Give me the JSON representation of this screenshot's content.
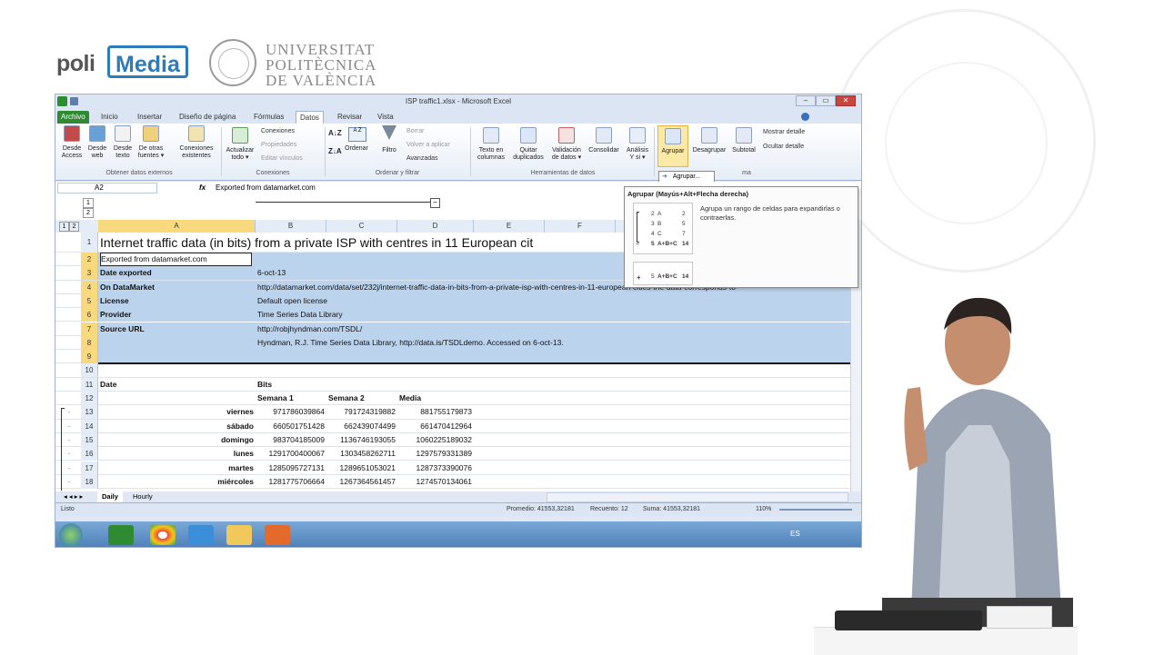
{
  "branding": {
    "poli": "poli",
    "media": "Media",
    "university_lines": [
      "UNIVERSITAT",
      "POLITÈCNICA",
      "DE VALÈNCIA"
    ]
  },
  "window": {
    "title": "ISP traffic1.xlsx - Microsoft Excel",
    "controls": [
      "–",
      "▭",
      "✕"
    ]
  },
  "tabs": [
    "Archivo",
    "Inicio",
    "Insertar",
    "Diseño de página",
    "Fórmulas",
    "Datos",
    "Revisar",
    "Vista"
  ],
  "active_tab": "Datos",
  "ribbon": {
    "get_external": {
      "buttons": [
        {
          "label1": "Desde",
          "label2": "Access"
        },
        {
          "label1": "Desde",
          "label2": "web"
        },
        {
          "label1": "Desde",
          "label2": "texto"
        },
        {
          "label1": "De otras",
          "label2": "fuentes ▾"
        },
        {
          "label1": "Conexiones",
          "label2": "existentes"
        }
      ],
      "group_label": "Obtener datos externos"
    },
    "connections": {
      "refresh": {
        "label1": "Actualizar",
        "label2": "todo ▾"
      },
      "items": [
        "Conexiones",
        "Propiedades",
        "Editar vínculos"
      ],
      "group_label": "Conexiones"
    },
    "sort_filter": {
      "order": "Ordenar",
      "filter": "Filtro",
      "items": [
        "Borrar",
        "Volver a aplicar",
        "Avanzadas"
      ],
      "group_label": "Ordenar y filtrar"
    },
    "data_tools": {
      "buttons": [
        {
          "label1": "Texto en",
          "label2": "columnas"
        },
        {
          "label1": "Quitar",
          "label2": "duplicados"
        },
        {
          "label1": "Validación",
          "label2": "de datos ▾"
        },
        {
          "label1": "Consolidar",
          "label2": ""
        },
        {
          "label1": "Análisis",
          "label2": "Y si ▾"
        }
      ],
      "group_label": "Herramientas de datos"
    },
    "outline": {
      "group": "Agrupar",
      "ungroup": "Desagrupar",
      "subtotal": "Subtotal",
      "show_detail": "Mostrar detalle",
      "hide_detail": "Ocultar detalle",
      "group_label": "ma",
      "submenu_item": "Agrupar..."
    }
  },
  "formula_bar": {
    "name_box": "A2",
    "fx": "fx",
    "content": "Exported from datamarket.com"
  },
  "outline_levels": [
    "1",
    "2"
  ],
  "columns": [
    "A",
    "B",
    "C",
    "D",
    "E",
    "F"
  ],
  "rows": [
    {
      "n": "1",
      "a": "Internet traffic data (in bits) from a private ISP with centres in 11 European cit"
    },
    {
      "n": "2",
      "a": "Exported from datamarket.com"
    },
    {
      "n": "3",
      "a": "Date exported",
      "b": "6-oct-13"
    },
    {
      "n": "4",
      "a": "On DataMarket",
      "b": "http://datamarket.com/data/set/232j/internet-traffic-data-in-bits-from-a-private-isp-with-centres-in-11-european-cities-the-data-corresponds-to-"
    },
    {
      "n": "5",
      "a": "License",
      "b": "Default open license"
    },
    {
      "n": "6",
      "a": "Provider",
      "b": "Time Series Data Library"
    },
    {
      "n": "7",
      "a": "Source URL",
      "b": "http://robjhyndman.com/TSDL/"
    },
    {
      "n": "8",
      "a": "",
      "b": "Hyndman, R.J.  Time Series Data Library, http://data.is/TSDLdemo. Accessed on 6-oct-13."
    },
    {
      "n": "9",
      "a": ""
    },
    {
      "n": "10",
      "a": ""
    },
    {
      "n": "11",
      "a": "Date",
      "b": "Bits"
    },
    {
      "n": "12",
      "a": "",
      "b": "Semana 1",
      "c": "Semana 2",
      "d": "Media"
    },
    {
      "n": "13",
      "a": "viernes",
      "b": "971786039864",
      "c": "791724319882",
      "d": "881755179873"
    },
    {
      "n": "14",
      "a": "sábado",
      "b": "660501751428",
      "c": "662439074499",
      "d": "661470412964"
    },
    {
      "n": "15",
      "a": "domingo",
      "b": "983704185009",
      "c": "1136746193055",
      "d": "1060225189032"
    },
    {
      "n": "16",
      "a": "lunes",
      "b": "1291700400067",
      "c": "1303458262711",
      "d": "1297579331389"
    },
    {
      "n": "17",
      "a": "martes",
      "b": "1285095727131",
      "c": "1289651053021",
      "d": "1287373390076"
    },
    {
      "n": "18",
      "a": "miércoles",
      "b": "1281775706664",
      "c": "1267364561457",
      "d": "1274570134061"
    }
  ],
  "sheet_tabs": [
    "Daily",
    "Hourly"
  ],
  "status": {
    "ready": "Listo",
    "average": "Promedio: 41553,32181",
    "count": "Recuento: 12",
    "sum": "Suma: 41553,32181",
    "zoom": "110%"
  },
  "tooltip": {
    "title": "Agrupar (Mayús+Alt+Flecha derecha)",
    "description": "Agrupa un rango de celdas para expandirlas o contraerlas.",
    "example_rows": [
      {
        "n": "2",
        "label": "A",
        "value": "2"
      },
      {
        "n": "3",
        "label": "B",
        "value": "5"
      },
      {
        "n": "4",
        "label": "C",
        "value": "7"
      },
      {
        "n": "5",
        "label": "A+B+C",
        "value": "14"
      }
    ],
    "collapsed_row": {
      "n": "5",
      "label": "A+B+C",
      "value": "14"
    }
  },
  "taskbar": {
    "lang": "ES"
  },
  "colors": {
    "excel_green": "#2e8b32",
    "selection_blue": "#bcd3ee",
    "header_highlight": "#f9d97e",
    "media_blue": "#2d7bb8"
  }
}
